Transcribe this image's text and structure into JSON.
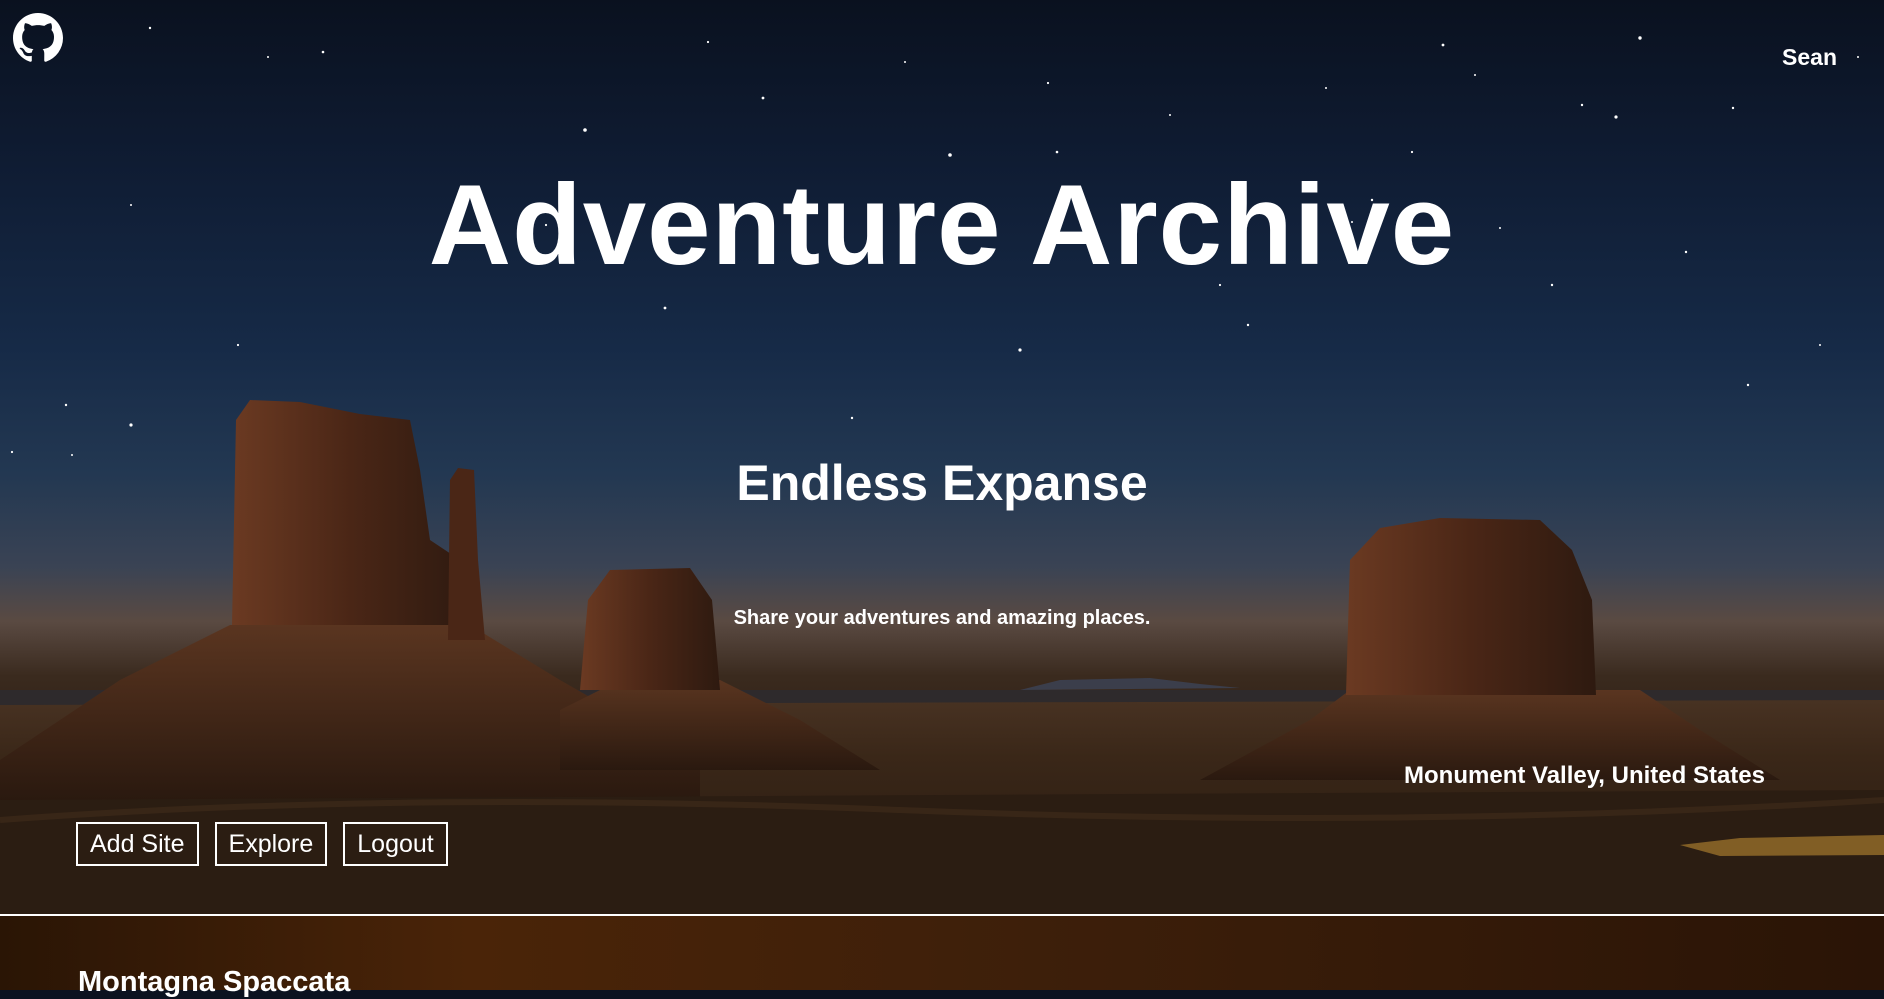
{
  "header": {
    "github_icon": "github-icon",
    "user_name": "Sean"
  },
  "hero": {
    "title": "Adventure Archive",
    "heading": "Endless Expanse",
    "subtitle": "Share your adventures and amazing places.",
    "location": "Monument Valley, United States"
  },
  "nav": {
    "add_site": "Add Site",
    "explore": "Explore",
    "logout": "Logout"
  },
  "section": {
    "first_site_title": "Montagna Spaccata"
  }
}
